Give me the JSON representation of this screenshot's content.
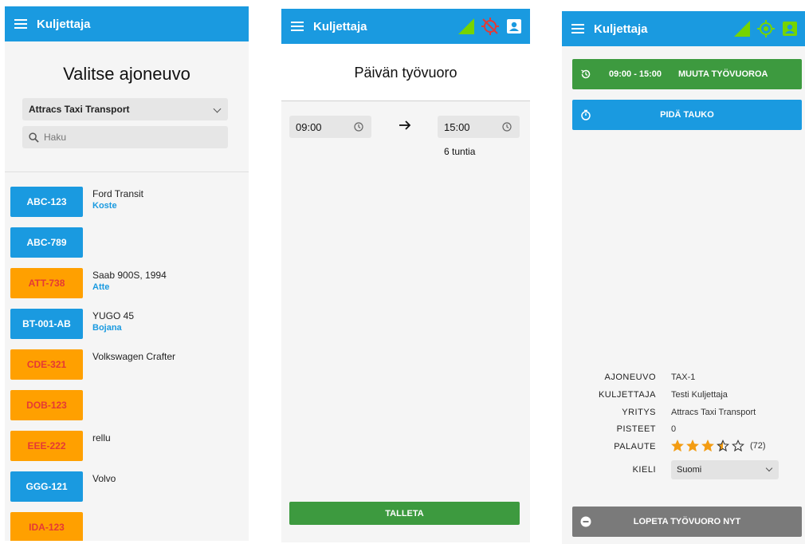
{
  "colors": {
    "appbar": "#1a9ae0",
    "green": "#3d9a3f",
    "orange": "#ffa000",
    "plate_text_red": "#e53935",
    "gray_button": "#7a7a7a",
    "star": "#f39c12",
    "signal": "#76d400",
    "no_location": "#e53935"
  },
  "app_title": "Kuljettaja",
  "vehicle_screen": {
    "title": "Valitse ajoneuvo",
    "company_select": "Attracs Taxi Transport",
    "search_placeholder": "Haku",
    "vehicles": [
      {
        "plate": "ABC-123",
        "color": "blue",
        "name": "Ford Transit",
        "driver": "Koste"
      },
      {
        "plate": "ABC-789",
        "color": "blue",
        "name": "",
        "driver": ""
      },
      {
        "plate": "ATT-738",
        "color": "orange",
        "name": "Saab 900S, 1994",
        "driver": "Atte"
      },
      {
        "plate": "BT-001-AB",
        "color": "blue",
        "name": "YUGO 45",
        "driver": "Bojana"
      },
      {
        "plate": "CDE-321",
        "color": "orange",
        "name": "Volkswagen Crafter",
        "driver": ""
      },
      {
        "plate": "DOB-123",
        "color": "orange",
        "name": "",
        "driver": ""
      },
      {
        "plate": "EEE-222",
        "color": "orange",
        "name": "rellu",
        "driver": ""
      },
      {
        "plate": "GGG-121",
        "color": "blue",
        "name": "Volvo",
        "driver": ""
      },
      {
        "plate": "IDA-123",
        "color": "orange",
        "name": "",
        "driver": ""
      }
    ]
  },
  "shift_screen": {
    "title": "Päivän työvuoro",
    "start_time": "09:00",
    "end_time": "15:00",
    "duration": "6 tuntia",
    "save_label": "TALLETA",
    "icons": [
      "signal-icon",
      "location-off-icon",
      "profile-icon"
    ]
  },
  "main_screen": {
    "shift_time": "09:00 - 15:00",
    "change_shift_label": "MUUTA TYÖVUOROA",
    "break_label": "PIDÄ TAUKO",
    "end_shift_label": "LOPETA TYÖVUORO NYT",
    "icons": [
      "signal-icon",
      "location-on-icon",
      "profile-icon"
    ],
    "info": {
      "vehicle_label": "AJONEUVO",
      "vehicle_value": "TAX-1",
      "driver_label": "KULJETTAJA",
      "driver_value": "Testi Kuljettaja",
      "company_label": "YRITYS",
      "company_value": "Attracs Taxi Transport",
      "points_label": "PISTEET",
      "points_value": "0",
      "feedback_label": "PALAUTE",
      "feedback_rating": 3.5,
      "feedback_count": "(72)",
      "language_label": "KIELI",
      "language_value": "Suomi"
    }
  }
}
